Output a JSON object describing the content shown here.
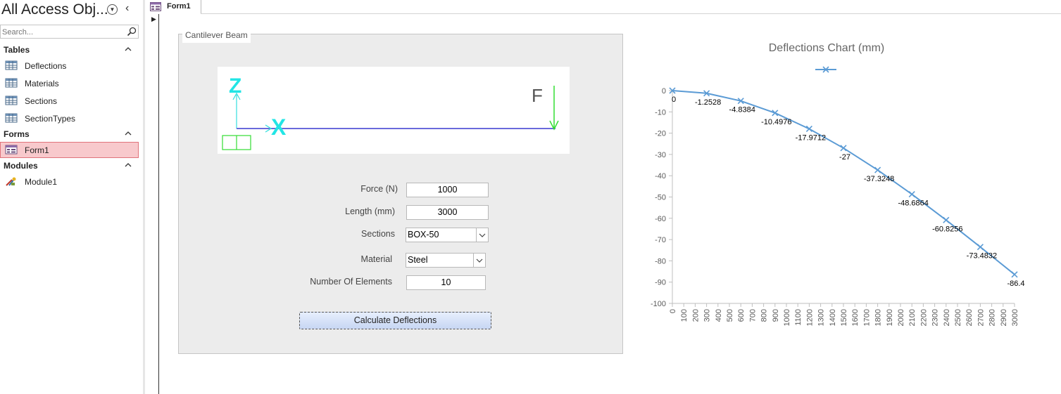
{
  "nav": {
    "title": "All Access Obj...",
    "search_placeholder": "Search...",
    "groups": [
      {
        "label": "Tables",
        "items": [
          "Deflections",
          "Materials",
          "Sections",
          "SectionTypes"
        ]
      },
      {
        "label": "Forms",
        "items": [
          "Form1"
        ]
      },
      {
        "label": "Modules",
        "items": [
          "Module1"
        ]
      }
    ]
  },
  "tab": {
    "label": "Form1"
  },
  "form": {
    "frame_caption": "Cantilever Beam",
    "diagram": {
      "z_label": "Z",
      "x_label": "X",
      "f_label": "F"
    },
    "force_label": "Force (N)",
    "force_value": "1000",
    "length_label": "Length (mm)",
    "length_value": "3000",
    "sections_label": "Sections",
    "sections_value": "BOX-50",
    "material_label": "Material",
    "material_value": "Steel",
    "elements_label": "Number Of Elements",
    "elements_value": "10",
    "calc_button": "Calculate Deflections"
  },
  "chart_data": {
    "type": "line",
    "title": "Deflections Chart (mm)",
    "series": [
      {
        "x": [
          0,
          300,
          600,
          900,
          1200,
          1500,
          1800,
          2100,
          2400,
          2700,
          3000
        ],
        "values": [
          0,
          -1.2528,
          -4.8384,
          -10.4976,
          -17.9712,
          -27,
          -37.3248,
          -48.6864,
          -60.8256,
          -73.4832,
          -86.4
        ],
        "labels": [
          "0",
          "-1.2528",
          "-4.8384",
          "-10.4976",
          "-17.9712",
          "-27",
          "-37.3248",
          "-48.6864",
          "-60.8256",
          "-73.4832",
          "-86.4"
        ]
      }
    ],
    "ylim": [
      -100,
      0
    ],
    "yticks": [
      "0",
      "-10",
      "-20",
      "-30",
      "-40",
      "-50",
      "-60",
      "-70",
      "-80",
      "-90",
      "-100"
    ],
    "xlim": [
      0,
      3000
    ],
    "xticks": [
      "0",
      "100",
      "200",
      "300",
      "400",
      "500",
      "600",
      "700",
      "800",
      "900",
      "1000",
      "1100",
      "1200",
      "1300",
      "1400",
      "1500",
      "1600",
      "1700",
      "1800",
      "1900",
      "2000",
      "2100",
      "2200",
      "2300",
      "2400",
      "2500",
      "2600",
      "2700",
      "2800",
      "2900",
      "3000"
    ],
    "legend": "top-center",
    "grid": false,
    "line_color": "#5b9bd5"
  }
}
